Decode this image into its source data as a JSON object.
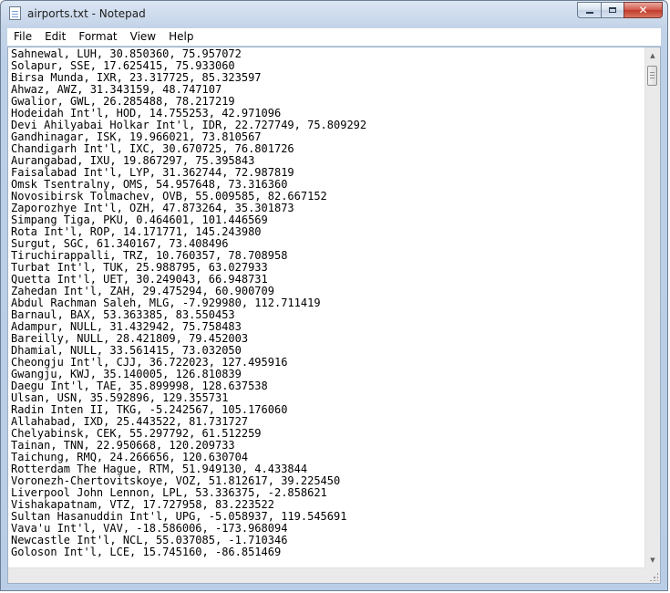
{
  "window": {
    "title": "airports.txt - Notepad"
  },
  "menu": [
    "File",
    "Edit",
    "Format",
    "View",
    "Help"
  ],
  "lines": [
    "Sahnewal, LUH, 30.850360, 75.957072",
    "Solapur, SSE, 17.625415, 75.933060",
    "Birsa Munda, IXR, 23.317725, 85.323597",
    "Ahwaz, AWZ, 31.343159, 48.747107",
    "Gwalior, GWL, 26.285488, 78.217219",
    "Hodeidah Int'l, HOD, 14.755253, 42.971096",
    "Devi Ahilyabai Holkar Int'l, IDR, 22.727749, 75.809292",
    "Gandhinagar, ISK, 19.966021, 73.810567",
    "Chandigarh Int'l, IXC, 30.670725, 76.801726",
    "Aurangabad, IXU, 19.867297, 75.395843",
    "Faisalabad Int'l, LYP, 31.362744, 72.987819",
    "Omsk Tsentralny, OMS, 54.957648, 73.316360",
    "Novosibirsk Tolmachev, OVB, 55.009585, 82.667152",
    "Zaporozhye Int'l, OZH, 47.873264, 35.301873",
    "Simpang Tiga, PKU, 0.464601, 101.446569",
    "Rota Int'l, ROP, 14.171771, 145.243980",
    "Surgut, SGC, 61.340167, 73.408496",
    "Tiruchirappalli, TRZ, 10.760357, 78.708958",
    "Turbat Int'l, TUK, 25.988795, 63.027933",
    "Quetta Int'l, UET, 30.249043, 66.948731",
    "Zahedan Int'l, ZAH, 29.475294, 60.900709",
    "Abdul Rachman Saleh, MLG, -7.929980, 112.711419",
    "Barnaul, BAX, 53.363385, 83.550453",
    "Adampur, NULL, 31.432942, 75.758483",
    "Bareilly, NULL, 28.421809, 79.452003",
    "Dhamial, NULL, 33.561415, 73.032050",
    "Cheongju Int'l, CJJ, 36.722023, 127.495916",
    "Gwangju, KWJ, 35.140005, 126.810839",
    "Daegu Int'l, TAE, 35.899998, 128.637538",
    "Ulsan, USN, 35.592896, 129.355731",
    "Radin Inten II, TKG, -5.242567, 105.176060",
    "Allahabad, IXD, 25.443522, 81.731727",
    "Chelyabinsk, CEK, 55.297792, 61.512259",
    "Tainan, TNN, 22.950668, 120.209733",
    "Taichung, RMQ, 24.266656, 120.630704",
    "Rotterdam The Hague, RTM, 51.949130, 4.433844",
    "Voronezh-Chertovitskoye, VOZ, 51.812617, 39.225450",
    "Liverpool John Lennon, LPL, 53.336375, -2.858621",
    "Vishakapatnam, VTZ, 17.727958, 83.223522",
    "Sultan Hasanuddin Int'l, UPG, -5.058937, 119.545691",
    "Vava'u Int'l, VAV, -18.586006, -173.968094",
    "Newcastle Int'l, NCL, 55.037085, -1.710346",
    "Goloson Int'l, LCE, 15.745160, -86.851469"
  ],
  "icons": {
    "app": "notepad-icon",
    "minimize": "minimize-icon",
    "maximize": "maximize-icon",
    "close": "close-icon"
  }
}
